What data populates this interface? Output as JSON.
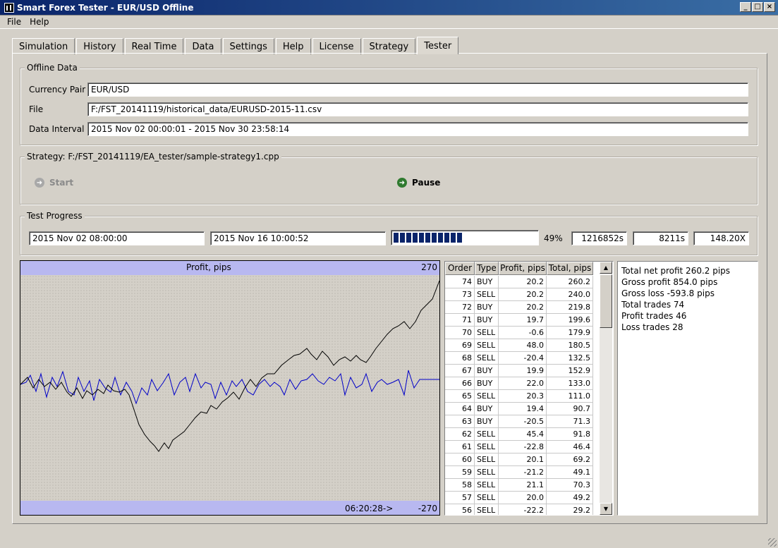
{
  "window": {
    "title": "Smart Forex Tester - EUR/USD Offline",
    "minimize": "_",
    "maximize": "□",
    "close": "×"
  },
  "menu": [
    "File",
    "Help"
  ],
  "tabs": [
    "Simulation",
    "History",
    "Real Time",
    "Data",
    "Settings",
    "Help",
    "License",
    "Strategy",
    "Tester"
  ],
  "active_tab": "Tester",
  "offline_data": {
    "title": "Offline Data",
    "currency_pair_label": "Currency Pair",
    "currency_pair": "EUR/USD",
    "file_label": "File",
    "file": "F:/FST_20141119/historical_data/EURUSD-2015-11.csv",
    "interval_label": "Data Interval",
    "interval": "2015 Nov 02 00:00:01 - 2015 Nov 30 23:58:14"
  },
  "strategy": {
    "title": "Strategy: F:/FST_20141119/EA_tester/sample-strategy1.cpp",
    "start_label": "Start",
    "pause_label": "Pause"
  },
  "progress": {
    "title": "Test Progress",
    "start_time": "2015 Nov 02 08:00:00",
    "current_time": "2015 Nov 16 10:00:52",
    "fraction": 0.49,
    "percent": "49%",
    "sim_seconds": "1216852s",
    "real_seconds": "8211s",
    "speed": "148.20X"
  },
  "chart": {
    "title": "Profit, pips",
    "y_max_label": "270",
    "y_min_label": "-270",
    "time_label": "06:20:28->",
    "ylim": [
      -270,
      270
    ],
    "line_color": "#0000c8",
    "cumulative_color": "#000000"
  },
  "table": {
    "headers": [
      "Order",
      "Type",
      "Profit, pips",
      "Total, pips"
    ],
    "rows": [
      [
        "74",
        "BUY",
        "20.2",
        "260.2"
      ],
      [
        "73",
        "SELL",
        "20.2",
        "240.0"
      ],
      [
        "72",
        "BUY",
        "20.2",
        "219.8"
      ],
      [
        "71",
        "BUY",
        "19.7",
        "199.6"
      ],
      [
        "70",
        "SELL",
        "-0.6",
        "179.9"
      ],
      [
        "69",
        "SELL",
        "48.0",
        "180.5"
      ],
      [
        "68",
        "SELL",
        "-20.4",
        "132.5"
      ],
      [
        "67",
        "BUY",
        "19.9",
        "152.9"
      ],
      [
        "66",
        "BUY",
        "22.0",
        "133.0"
      ],
      [
        "65",
        "SELL",
        "20.3",
        "111.0"
      ],
      [
        "64",
        "BUY",
        "19.4",
        "90.7"
      ],
      [
        "63",
        "BUY",
        "-20.5",
        "71.3"
      ],
      [
        "62",
        "SELL",
        "45.4",
        "91.8"
      ],
      [
        "61",
        "SELL",
        "-22.8",
        "46.4"
      ],
      [
        "60",
        "SELL",
        "20.1",
        "69.2"
      ],
      [
        "59",
        "SELL",
        "-21.2",
        "49.1"
      ],
      [
        "58",
        "SELL",
        "21.1",
        "70.3"
      ],
      [
        "57",
        "SELL",
        "20.0",
        "49.2"
      ],
      [
        "56",
        "SELL",
        "-22.2",
        "29.2"
      ]
    ]
  },
  "stats": [
    "Total net profit 260.2 pips",
    "Gross profit 854.0 pips",
    "Gross loss -593.8 pips",
    "Total trades 74",
    "Profit trades 46",
    "Loss trades 28"
  ]
}
